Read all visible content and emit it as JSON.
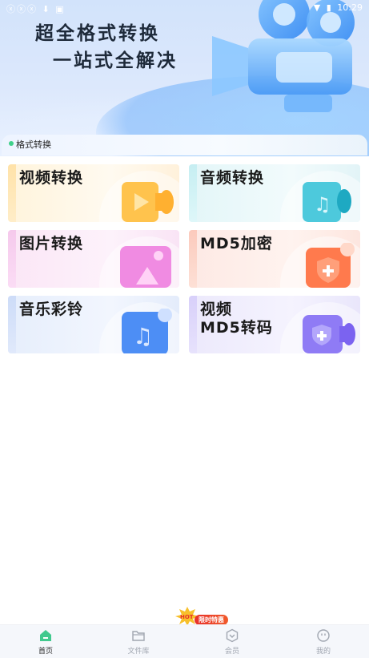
{
  "status_bar": {
    "left_icons": "ⓧⓧⓧ ⬇ ▣",
    "time": "10:29",
    "wifi_icon": "wifi-icon",
    "battery_icon": "battery-icon"
  },
  "hero": {
    "title": "超全格式转换",
    "subtitle": "一站式全解决"
  },
  "section": {
    "label": "格式转换"
  },
  "cards": [
    {
      "title": "视频转换",
      "icon": "video-play-icon",
      "accent": "#ffb13b"
    },
    {
      "title": "音频转换",
      "icon": "music-note-icon",
      "accent": "#1fb0c9"
    },
    {
      "title": "图片转换",
      "icon": "image-icon",
      "accent": "#e45fd3"
    },
    {
      "title": "MD5加密",
      "icon": "shield-plus-icon",
      "accent": "#ff6a3d"
    },
    {
      "title": "音乐彩铃",
      "icon": "music-note-icon",
      "accent": "#3c7ff0"
    },
    {
      "title_line1": "视频",
      "title_line2": "MD5转码",
      "icon": "video-shield-icon",
      "accent": "#7b63f0"
    }
  ],
  "bottom_nav": {
    "items": [
      {
        "label": "首页",
        "icon": "home-icon",
        "active": true
      },
      {
        "label": "文件库",
        "icon": "folder-icon",
        "active": false
      },
      {
        "label": "会员",
        "icon": "vip-icon",
        "active": false
      },
      {
        "label": "我的",
        "icon": "profile-icon",
        "active": false
      }
    ],
    "promo": "限时特惠",
    "promo_burst": "HOT"
  },
  "colors": {
    "active_nav": "#41c98e",
    "inactive_nav": "#a0a6b0",
    "promo": "#e8302a"
  }
}
